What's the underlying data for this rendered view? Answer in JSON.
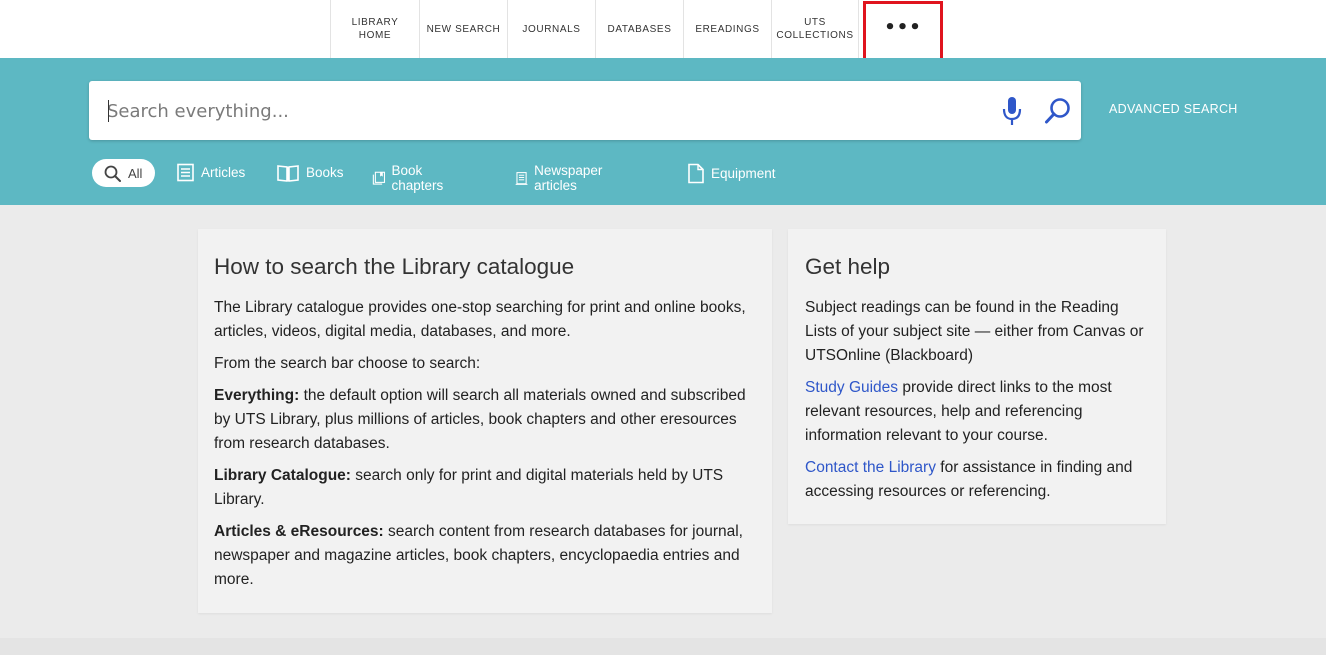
{
  "nav": {
    "items": [
      {
        "line1": "LIBRARY",
        "line2": "HOME"
      },
      {
        "line1": "NEW SEARCH",
        "line2": ""
      },
      {
        "line1": "JOURNALS",
        "line2": ""
      },
      {
        "line1": "DATABASES",
        "line2": ""
      },
      {
        "line1": "EREADINGS",
        "line2": ""
      },
      {
        "line1": "UTS",
        "line2": "COLLECTIONS"
      }
    ],
    "more_label": "•••",
    "highlight_color": "#e0141e"
  },
  "search": {
    "placeholder": "Search everything...",
    "value": "",
    "advanced_label": "ADVANCED SEARCH",
    "band_color": "#5db8c3",
    "accent_color": "#2f57c9"
  },
  "filters": {
    "all_label": "All",
    "items": [
      {
        "label": "Articles",
        "icon": "article-icon"
      },
      {
        "label": "Books",
        "icon": "book-icon"
      },
      {
        "label": "Book chapters",
        "icon": "book-chapters-icon"
      },
      {
        "label": "Newspaper articles",
        "icon": "newspaper-icon"
      },
      {
        "label": "Equipment",
        "icon": "document-icon"
      }
    ]
  },
  "howto": {
    "title": "How to search the Library catalogue",
    "intro": "The Library catalogue provides one-stop searching for print and online books, articles, videos, digital media, databases, and more.",
    "choose": "From the search bar choose to search:",
    "everything_term": "Everything:",
    "everything_text": " the default option will search all materials owned and subscribed by UTS Library, plus millions of articles, book chapters and other eresources from research databases.",
    "catalogue_term": "Library Catalogue:",
    "catalogue_text": " search only for print and digital materials held by UTS Library.",
    "articles_term": "Articles & eResources:",
    "articles_text": " search content from research databases for journal, newspaper and magazine articles, book chapters, encyclopaedia entries and more."
  },
  "help": {
    "title": "Get help",
    "readings": "Subject readings can be found in the Reading Lists of your subject site — either from Canvas or UTSOnline (Blackboard)",
    "guides_link": "Study Guides",
    "guides_text": " provide direct links to the most relevant resources, help and referencing information relevant to your course.",
    "contact_link": "Contact the Library",
    "contact_text": " for assistance in finding and accessing resources or referencing."
  }
}
